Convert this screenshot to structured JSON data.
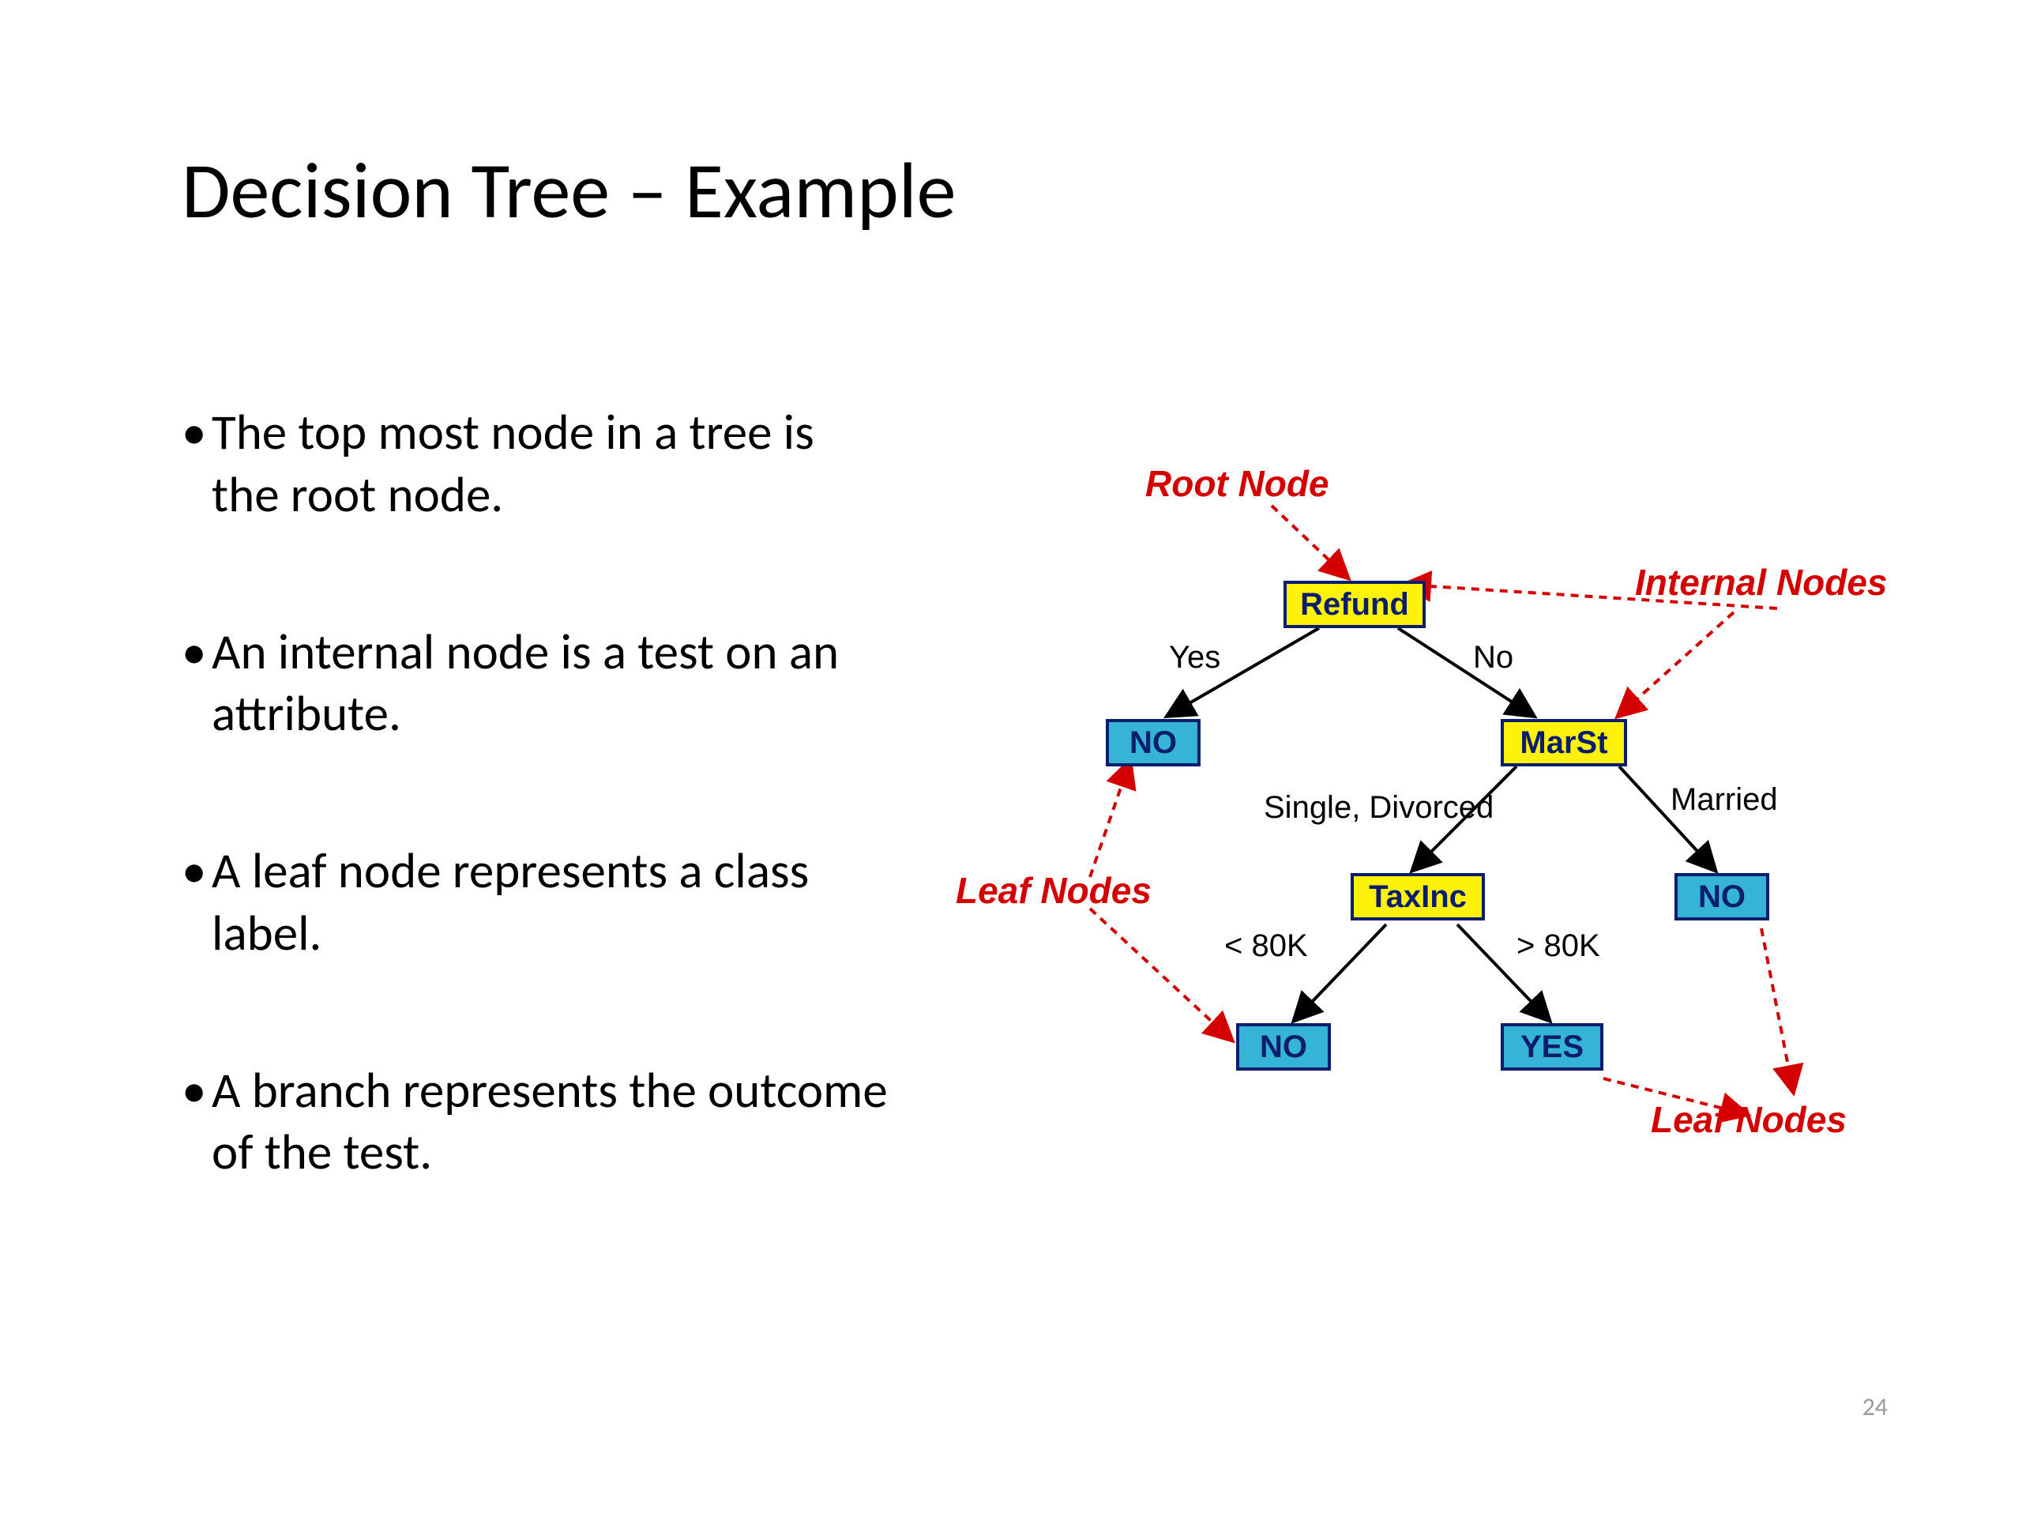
{
  "title": "Decision Tree – Example",
  "bullets": [
    "The top most node in a tree is the root node.",
    "An internal node is a test on an attribute.",
    "A leaf node represents a class label.",
    "A branch represents the outcome of the test."
  ],
  "page_number": "24",
  "diagram": {
    "captions": {
      "root": "Root Node",
      "internal": "Internal Nodes",
      "leaf_left": "Leaf Nodes",
      "leaf_right": "Leaf Nodes"
    },
    "nodes": {
      "refund": "Refund",
      "marst": "MarSt",
      "taxinc": "TaxInc",
      "no1": "NO",
      "no2": "NO",
      "no3": "NO",
      "yes": "YES"
    },
    "edges": {
      "yes": "Yes",
      "no": "No",
      "single_divorced": "Single, Divorced",
      "married": "Married",
      "lt80k": "< 80K",
      "gt80k": "> 80K"
    }
  }
}
